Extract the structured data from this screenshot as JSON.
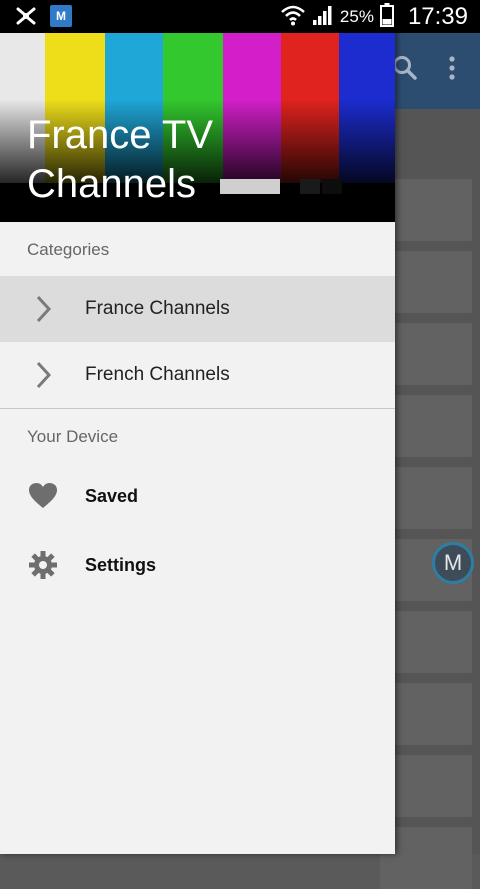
{
  "status_bar": {
    "battery_percent": "25%",
    "time": "17:39",
    "icons": [
      "bluetooth-like-icon",
      "app-m-icon",
      "wifi-icon",
      "signal-icon",
      "battery-icon"
    ]
  },
  "app_bar": {
    "icons": [
      "search-icon",
      "overflow-menu-icon"
    ]
  },
  "drawer": {
    "header_title": "France TV Channels",
    "colors": {
      "bars": [
        "#ffffff",
        "#f1e21a",
        "#1fa7d8",
        "#33c82e",
        "#d21fc9",
        "#e0231e",
        "#1c2ccf",
        "#111111"
      ]
    },
    "sections": [
      {
        "label": "Categories",
        "items": [
          {
            "label": "France Channels",
            "icon": "chevron-right-icon",
            "selected": true
          },
          {
            "label": "French Channels",
            "icon": "chevron-right-icon",
            "selected": false
          }
        ]
      },
      {
        "label": "Your Device",
        "items": [
          {
            "label": "Saved",
            "icon": "heart-icon"
          },
          {
            "label": "Settings",
            "icon": "gear-icon"
          }
        ]
      }
    ]
  },
  "floating_button": {
    "label": "M"
  }
}
